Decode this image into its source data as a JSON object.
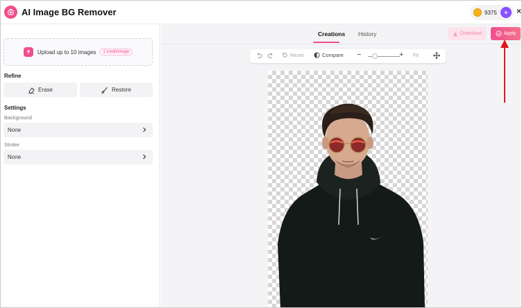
{
  "header": {
    "app_title": "AI Image BG Remover",
    "credits": "9375",
    "plus_label": "+",
    "close_label": "×"
  },
  "left_panel": {
    "upload_text": "Upload up to 10 images",
    "credit_badge": "1 credit/image",
    "refine_label": "Refine",
    "erase_label": "Erase",
    "restore_label": "Restore",
    "settings_label": "Settings",
    "background_label": "Background",
    "background_value": "None",
    "stroke_label": "Stroke",
    "stroke_value": "None"
  },
  "main": {
    "tabs": [
      {
        "label": "Creations",
        "active": true
      },
      {
        "label": "History",
        "active": false
      }
    ],
    "download_label": "Download",
    "apply_label": "Apply",
    "toolbar": {
      "reset_label": "Reset",
      "compare_label": "Compare",
      "zoom_out_label": "−",
      "zoom_in_label": "+",
      "fit_label": "Fit"
    }
  },
  "colors": {
    "accent": "#f04e8c",
    "credit_coin": "#f6b21a",
    "plus": "#8a4fff",
    "annotation_arrow": "#e01818"
  },
  "icons": [
    "app-logo-icon",
    "coin-icon",
    "upload-icon",
    "eraser-icon",
    "brush-icon",
    "chevron-right-icon",
    "undo-icon",
    "redo-icon",
    "reset-icon",
    "compare-icon",
    "move-icon",
    "download-icon",
    "check-circle-icon"
  ]
}
